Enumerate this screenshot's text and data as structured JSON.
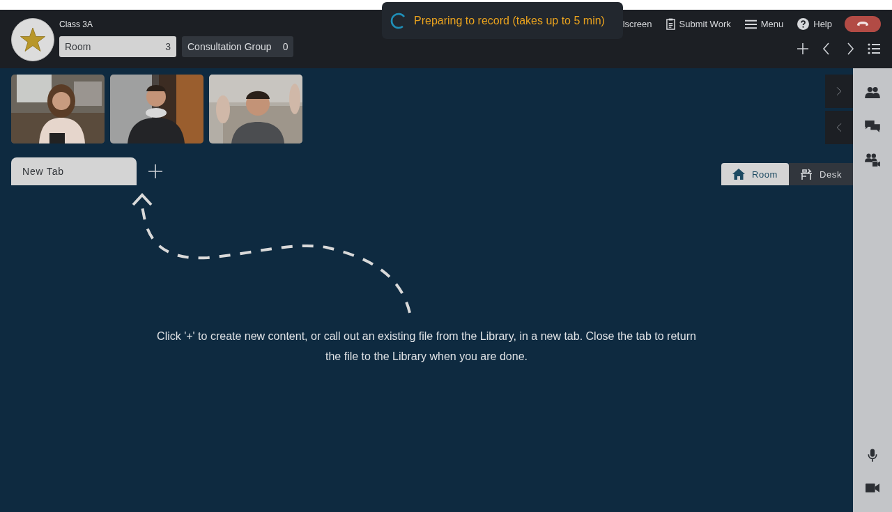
{
  "header": {
    "class_name": "Class 3A",
    "groups": [
      {
        "label": "Room",
        "count": "3",
        "selected": true
      },
      {
        "label": "Consultation Group",
        "count": "0",
        "selected": false
      }
    ]
  },
  "toast": {
    "text": "Preparing to record (takes up to 5 min)"
  },
  "toolbar": [
    {
      "kind": "fullscreen",
      "label": "lscreen"
    },
    {
      "kind": "submit",
      "label": "Submit Work"
    },
    {
      "kind": "menu",
      "label": "Menu"
    },
    {
      "kind": "help",
      "label": "Help"
    },
    {
      "kind": "hangup"
    }
  ],
  "tabs": [
    {
      "label": "New Tab",
      "selected": true
    }
  ],
  "view_toggle": [
    {
      "kind": "room",
      "label": "Room",
      "selected": true
    },
    {
      "kind": "desk",
      "label": "Desk",
      "selected": false
    }
  ],
  "hint": "Click '+' to create new content, or call out an existing file from the Library, in a new tab. Close the tab to return the file to the Library when you are done."
}
